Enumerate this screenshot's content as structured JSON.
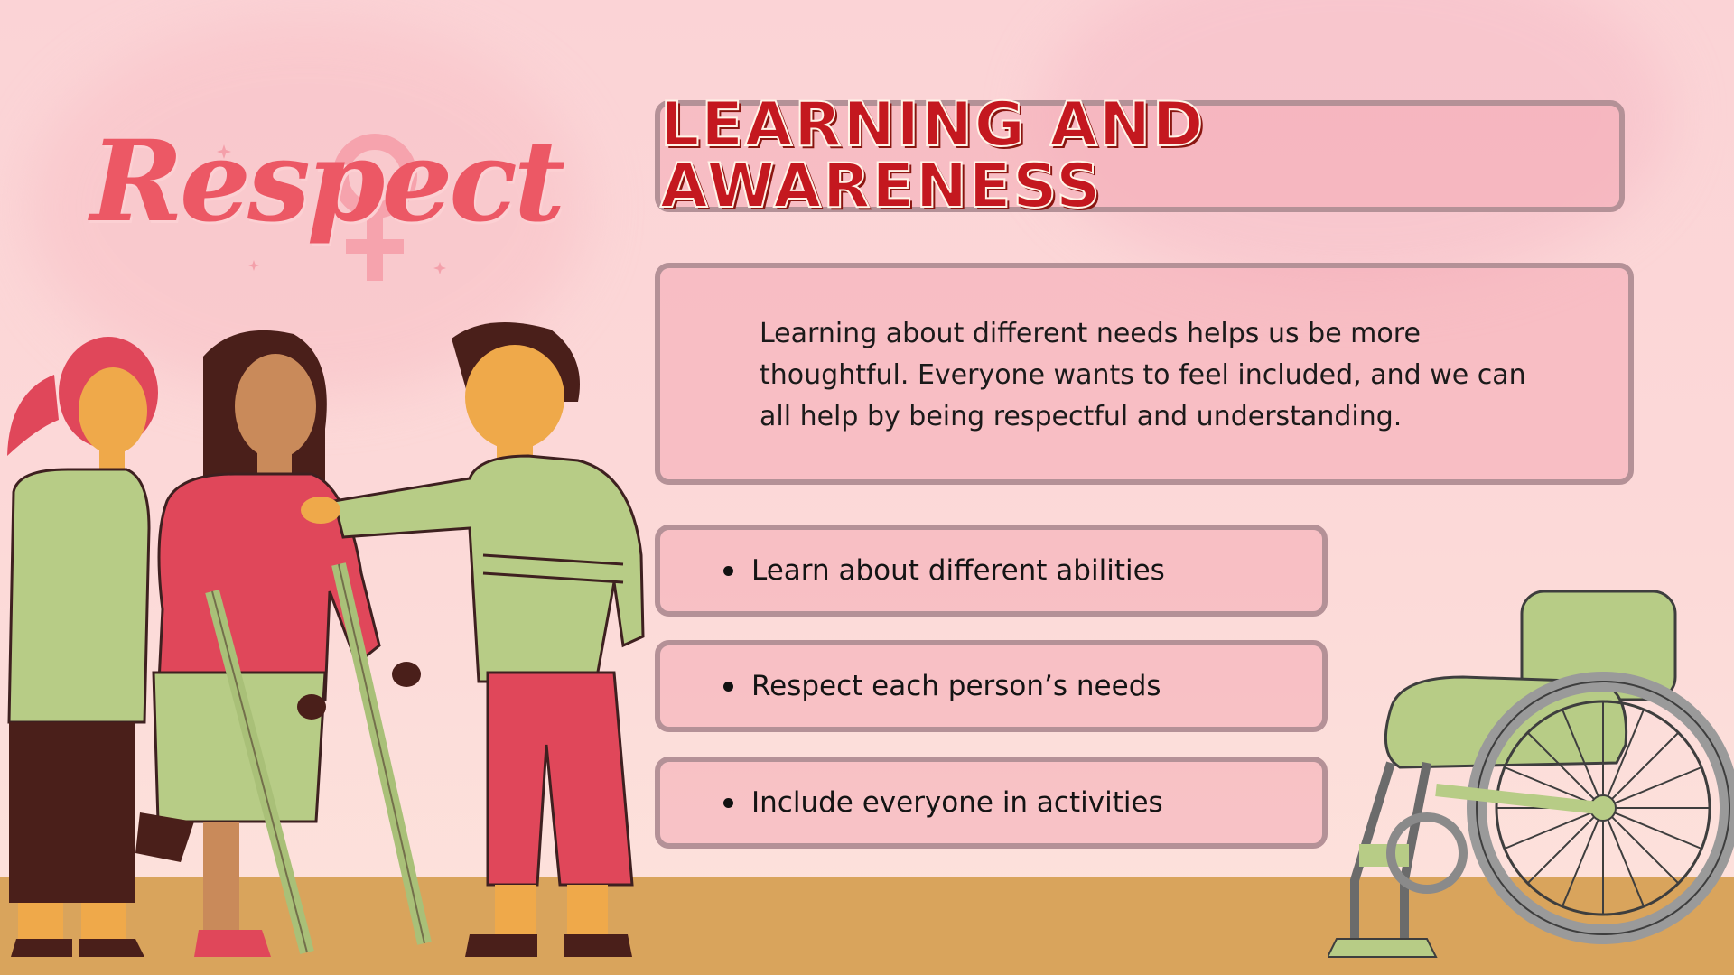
{
  "slide": {
    "logo": "Respect",
    "title": "LEARNING AND AWARENESS",
    "description": "Learning about different needs helps us be more thoughtful. Everyone wants to feel included, and we can all help by being respectful and understanding.",
    "bullets": [
      "Learn about different abilities",
      "Respect each person’s needs",
      "Include everyone in activities"
    ]
  },
  "colors": {
    "background": "#fbd3d6",
    "title_red": "#c4181f",
    "logo_coral": "#ec5865",
    "panel_border": "#b49197",
    "floor": "#d9a45c",
    "sage": "#b7cc86",
    "raspberry": "#e0475a"
  },
  "icons": [
    "venus-symbol-icon",
    "sparkle-icon",
    "wheelchair-icon",
    "crutches-icon"
  ]
}
